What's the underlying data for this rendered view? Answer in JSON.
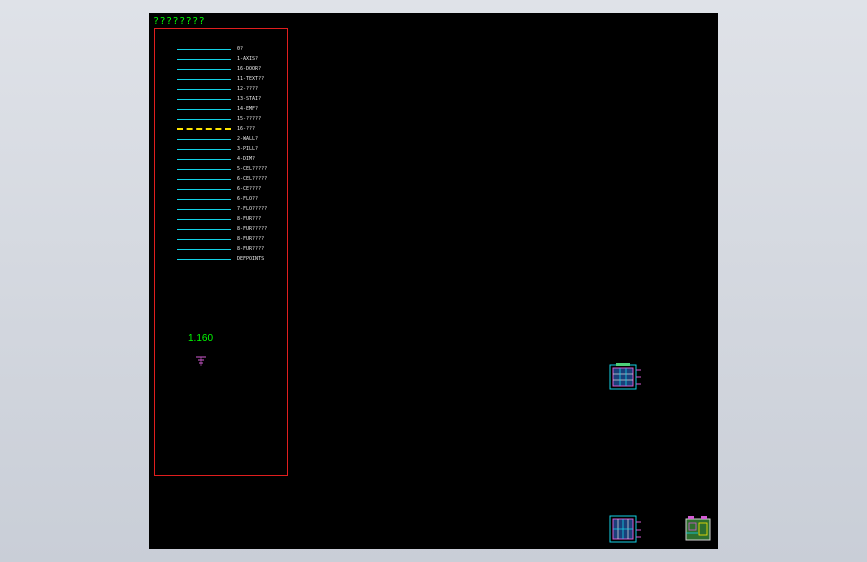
{
  "drawing": {
    "title": "????????",
    "scale_label": "1.160"
  },
  "legend": [
    {
      "label": "0?",
      "style": "solid"
    },
    {
      "label": "1-AXIS?",
      "style": "solid"
    },
    {
      "label": "16-DOOR?",
      "style": "solid"
    },
    {
      "label": "11-TEXT??",
      "style": "solid"
    },
    {
      "label": "12-????",
      "style": "solid"
    },
    {
      "label": "13-STAI?",
      "style": "solid"
    },
    {
      "label": "14-EMF?",
      "style": "solid"
    },
    {
      "label": "15-?????",
      "style": "solid"
    },
    {
      "label": "16-???",
      "style": "dashed"
    },
    {
      "label": "2-WALL?",
      "style": "solid"
    },
    {
      "label": "3-PILL?",
      "style": "solid"
    },
    {
      "label": "4-DIM?",
      "style": "solid"
    },
    {
      "label": "5-CEL?????",
      "style": "solid"
    },
    {
      "label": "6-CEL?????",
      "style": "solid"
    },
    {
      "label": "6-CE????",
      "style": "solid"
    },
    {
      "label": "6-FLO??",
      "style": "solid"
    },
    {
      "label": "7-FLO?????",
      "style": "solid"
    },
    {
      "label": "8-FUR???",
      "style": "solid"
    },
    {
      "label": "8-FUR?????",
      "style": "solid"
    },
    {
      "label": "8-FUR????",
      "style": "solid"
    },
    {
      "label": "8-FUR????",
      "style": "solid"
    },
    {
      "label": "DEFPOINTS",
      "style": "solid"
    }
  ],
  "colors": {
    "background": "#000000",
    "frame": "#e01e1e",
    "legend_line": "#14d2e6",
    "dashed_line": "#ffe600",
    "title_text": "#00ff00",
    "label_text": "#e8e8e8"
  },
  "thumbnails": [
    {
      "name": "floor-plan-thumbnail-1",
      "icon": "floor-plan-icon"
    },
    {
      "name": "floor-plan-thumbnail-2",
      "icon": "floor-plan-icon"
    },
    {
      "name": "floor-plan-thumbnail-3",
      "icon": "floor-plan-icon"
    }
  ]
}
